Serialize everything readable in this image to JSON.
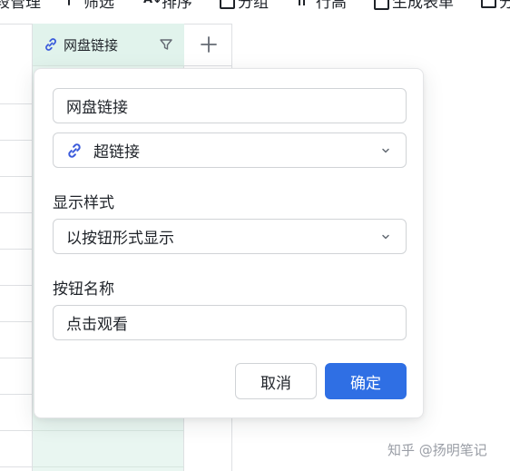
{
  "toolbar": {
    "items": [
      {
        "label": "段管理",
        "icon": "field-manage-icon"
      },
      {
        "label": "筛选",
        "icon": "filter-icon"
      },
      {
        "label": "排序",
        "icon": "sort-icon"
      },
      {
        "label": "分组",
        "icon": "group-icon"
      },
      {
        "label": "行高",
        "icon": "row-height-icon"
      },
      {
        "label": "生成表单",
        "icon": "form-icon"
      },
      {
        "label": "分",
        "icon": "share-icon"
      }
    ]
  },
  "table": {
    "column_header": {
      "label": "网盘链接",
      "icon": "link-icon",
      "filter_icon": "filter-icon"
    },
    "add_column_icon": "plus-icon"
  },
  "panel": {
    "field_name": "网盘链接",
    "field_type": {
      "label": "超链接",
      "icon": "link-icon"
    },
    "display_style_label": "显示样式",
    "display_style_value": "以按钮形式显示",
    "button_name_label": "按钮名称",
    "button_name_value": "点击观看",
    "cancel_label": "取消",
    "confirm_label": "确定"
  },
  "colors": {
    "accent": "#2f6fe4",
    "link_icon": "#3b5bdb",
    "column_highlight": "#e9f6f1"
  },
  "watermark": "知乎 @扬明笔记"
}
